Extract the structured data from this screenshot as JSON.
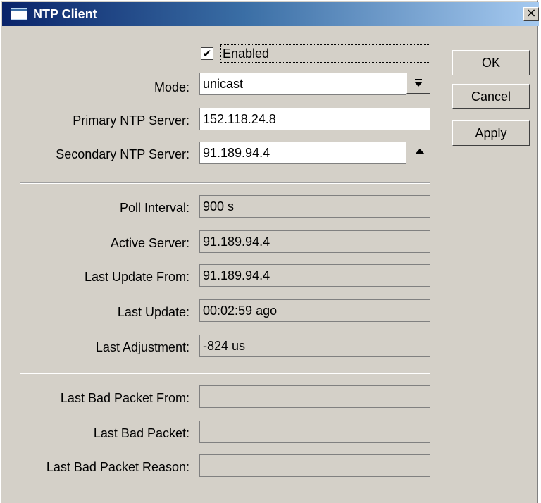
{
  "window": {
    "title": "NTP Client",
    "close_glyph": "×"
  },
  "form": {
    "enabled_label": "Enabled",
    "enabled_checked": true,
    "checkmark": "✔",
    "mode_label": "Mode:",
    "mode_value": "unicast",
    "primary_label": "Primary NTP Server:",
    "primary_value": "152.118.24.8",
    "secondary_label": "Secondary NTP Server:",
    "secondary_value": "91.189.94.4",
    "poll_label": "Poll Interval:",
    "poll_value": "900 s",
    "active_label": "Active Server:",
    "active_value": "91.189.94.4",
    "last_update_from_label": "Last Update From:",
    "last_update_from_value": "91.189.94.4",
    "last_update_label": "Last Update:",
    "last_update_value": "00:02:59 ago",
    "last_adjustment_label": "Last Adjustment:",
    "last_adjustment_value": "-824 us",
    "bad_from_label": "Last Bad Packet From:",
    "bad_from_value": "",
    "bad_packet_label": "Last Bad Packet:",
    "bad_packet_value": "",
    "bad_reason_label": "Last Bad Packet Reason:",
    "bad_reason_value": ""
  },
  "buttons": {
    "ok": "OK",
    "cancel": "Cancel",
    "apply": "Apply"
  },
  "icons": {
    "title": "window-icon",
    "dropdown": "dropdown-arrow-icon",
    "collapse": "up-arrow-icon"
  }
}
